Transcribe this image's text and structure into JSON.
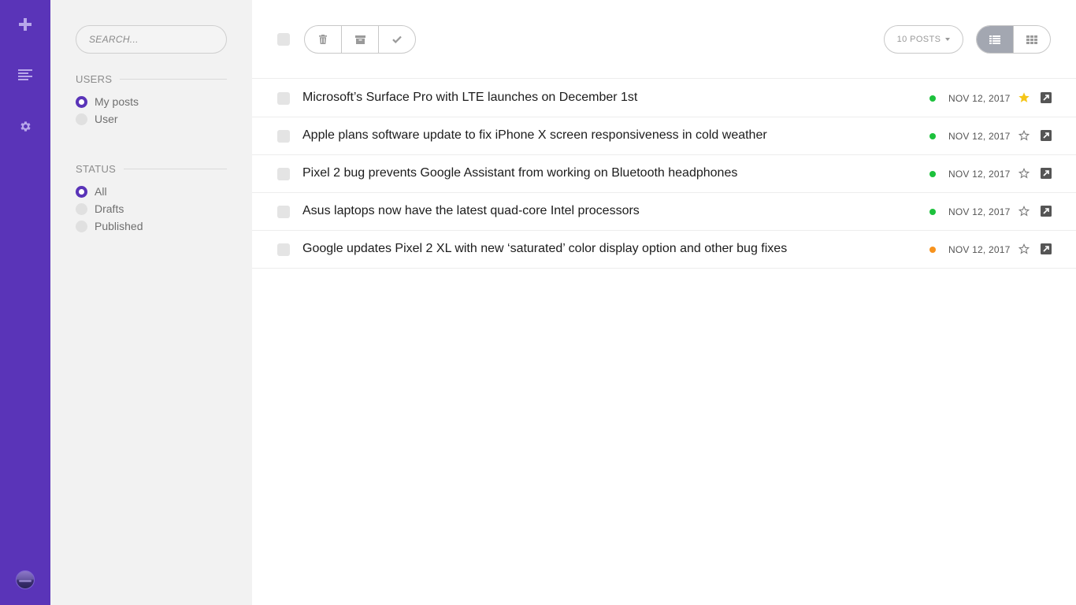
{
  "rail": {
    "items": [
      {
        "name": "new-post",
        "icon": "plus-icon"
      },
      {
        "name": "posts",
        "icon": "list-icon"
      },
      {
        "name": "settings",
        "icon": "gear-icon"
      }
    ],
    "avatar_icon": "user-avatar"
  },
  "filters": {
    "search_placeholder": "SEARCH...",
    "users": {
      "title": "USERS",
      "options": [
        {
          "label": "My posts",
          "selected": true
        },
        {
          "label": "User",
          "selected": false
        }
      ]
    },
    "status": {
      "title": "STATUS",
      "options": [
        {
          "label": "All",
          "selected": true
        },
        {
          "label": "Drafts",
          "selected": false
        },
        {
          "label": "Published",
          "selected": false
        }
      ]
    }
  },
  "toolbar": {
    "actions": [
      {
        "name": "delete",
        "icon": "trash-icon"
      },
      {
        "name": "archive",
        "icon": "archive-icon"
      },
      {
        "name": "publish",
        "icon": "check-icon"
      }
    ],
    "posts_per_page": "10 POSTS",
    "view_modes": [
      {
        "name": "list",
        "icon": "list-view-icon",
        "active": true
      },
      {
        "name": "grid",
        "icon": "grid-view-icon",
        "active": false
      }
    ]
  },
  "colors": {
    "brand": "#5a34b8",
    "published": "#1cc13c",
    "draft": "#f7931e",
    "star_active": "#f5c518"
  },
  "posts": [
    {
      "title": "Microsoft’s Surface Pro with LTE launches on December 1st",
      "date": "NOV 12, 2017",
      "status": "published",
      "starred": true
    },
    {
      "title": "Apple plans software update to fix iPhone X screen responsiveness in cold weather",
      "date": "NOV 12, 2017",
      "status": "published",
      "starred": false
    },
    {
      "title": "Pixel 2 bug prevents Google Assistant from working on Bluetooth headphones",
      "date": "NOV 12, 2017",
      "status": "published",
      "starred": false
    },
    {
      "title": "Asus laptops now have the latest quad-core Intel processors",
      "date": "NOV 12, 2017",
      "status": "published",
      "starred": false
    },
    {
      "title": "Google updates Pixel 2 XL with new ‘saturated’ color display option and other bug fixes",
      "date": "NOV 12, 2017",
      "status": "draft",
      "starred": false
    }
  ]
}
